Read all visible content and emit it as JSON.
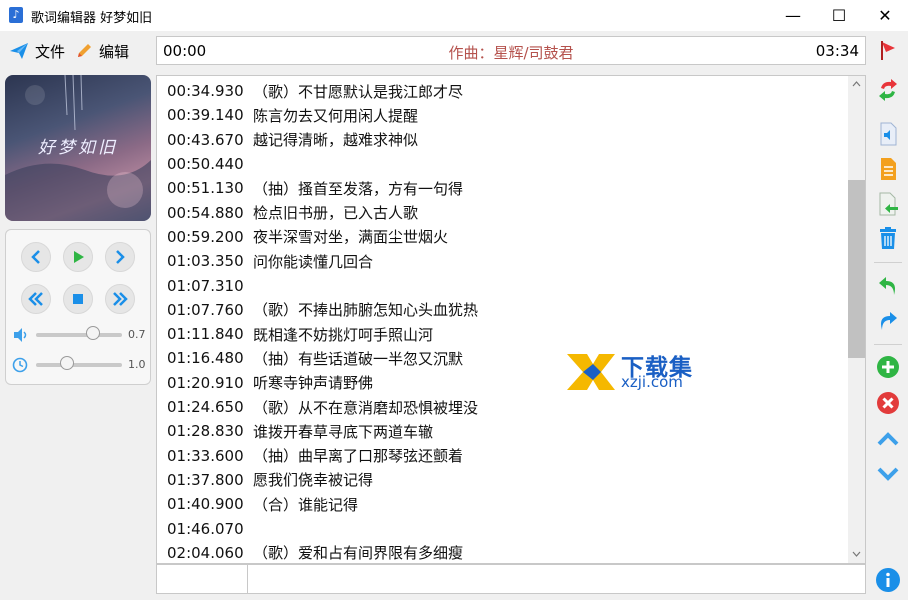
{
  "window": {
    "title": "歌词编辑器 好梦如旧",
    "minimize_glyph": "—",
    "maximize_glyph": "☐",
    "close_glyph": "✕"
  },
  "menu": {
    "file_label": "文件",
    "edit_label": "编辑"
  },
  "timebar": {
    "start": "00:00",
    "composer": "作曲：星辉/司鼓君",
    "end": "03:34"
  },
  "album": {
    "art_text": "好梦如旧"
  },
  "player": {
    "volume_value": "0.7",
    "volume_level": 0.7,
    "speed_value": "1.0",
    "speed_level": 0.33
  },
  "lyrics": [
    {
      "time": "00:34.930",
      "text": "（歌）不甘愿默认是我江郎才尽"
    },
    {
      "time": "00:39.140",
      "text": "陈言勿去又何用闲人提醒"
    },
    {
      "time": "00:43.670",
      "text": "越记得清晰，越难求神似"
    },
    {
      "time": "00:50.440",
      "text": ""
    },
    {
      "time": "00:51.130",
      "text": "（抽）搔首至发落，方有一句得"
    },
    {
      "time": "00:54.880",
      "text": "检点旧书册，已入古人歌"
    },
    {
      "time": "00:59.200",
      "text": "夜半深雪对坐，满面尘世烟火"
    },
    {
      "time": "01:03.350",
      "text": "问你能读懂几回合"
    },
    {
      "time": "01:07.310",
      "text": ""
    },
    {
      "time": "01:07.760",
      "text": "（歌）不捧出肺腑怎知心头血犹热"
    },
    {
      "time": "01:11.840",
      "text": "既相逢不妨挑灯呵手照山河"
    },
    {
      "time": "01:16.480",
      "text": "（抽）有些话道破一半忽又沉默"
    },
    {
      "time": "01:20.910",
      "text": "听寒寺钟声请野佛"
    },
    {
      "time": "01:24.650",
      "text": "（歌）从不在意消磨却恐惧被埋没"
    },
    {
      "time": "01:28.830",
      "text": "谁拨开春草寻底下两道车辙"
    },
    {
      "time": "01:33.600",
      "text": "（抽）曲早离了口那琴弦还颤着"
    },
    {
      "time": "01:37.800",
      "text": "愿我们侥幸被记得"
    },
    {
      "time": "01:40.900",
      "text": "（合）谁能记得"
    },
    {
      "time": "01:46.070",
      "text": ""
    },
    {
      "time": "02:04.060",
      "text": "（歌）爱和占有间界限有多细瘦"
    }
  ],
  "watermark": {
    "cn": "下载集",
    "url": "xzji.com"
  },
  "right_toolbar": [
    "refresh-icon",
    "audio-icon",
    "document-icon",
    "export-icon",
    "trash-icon",
    "undo-icon",
    "redo-icon",
    "add-icon",
    "delete-icon",
    "move-up-icon",
    "move-down-icon",
    "info-icon"
  ],
  "colors": {
    "accent": "#1a8fe8",
    "composer": "#b5524d",
    "add": "#2fb544",
    "delete": "#e23b3b"
  }
}
